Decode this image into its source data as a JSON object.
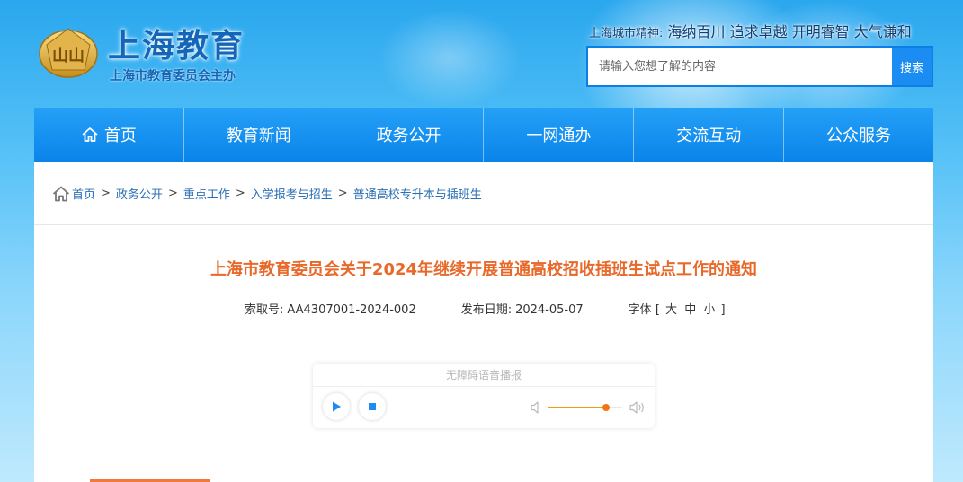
{
  "header": {
    "site_title": "上海教育",
    "site_subtitle": "上海市教育委员会主办",
    "logo_text": "山山",
    "slogan_label": "上海城市精神:",
    "slogan_text": "海纳百川 追求卓越 开明睿智 大气谦和",
    "search": {
      "placeholder": "请输入您想了解的内容",
      "button_label": "搜索"
    }
  },
  "nav": {
    "items": [
      {
        "label": "首页",
        "icon": "home-icon"
      },
      {
        "label": "教育新闻"
      },
      {
        "label": "政务公开"
      },
      {
        "label": "一网通办"
      },
      {
        "label": "交流互动"
      },
      {
        "label": "公众服务"
      }
    ]
  },
  "breadcrumb": {
    "icon": "home-icon",
    "items": [
      "首页",
      "政务公开",
      "重点工作",
      "入学报考与招生",
      "普通高校专升本与插班生"
    ],
    "separator": ">"
  },
  "article": {
    "title": "上海市教育委员会关于2024年继续开展普通高校招收插班生试点工作的通知",
    "index_label": "索取号:",
    "index_value": "AA4307001-2024-002",
    "date_label": "发布日期:",
    "date_value": "2024-05-07",
    "font_label": "字体",
    "font_open": "[",
    "font_sizes": [
      "大",
      "中",
      "小"
    ],
    "font_close": "]"
  },
  "player": {
    "title": "无障碍语音播报",
    "play_icon": "play-icon",
    "stop_icon": "stop-icon",
    "volume_level": 0.78
  },
  "colors": {
    "nav_bg": "#0a84ea",
    "title_orange": "#e8692a",
    "link_blue": "#2a6fb5",
    "brand_blue": "#1466b8",
    "volume_orange": "#f37412"
  }
}
